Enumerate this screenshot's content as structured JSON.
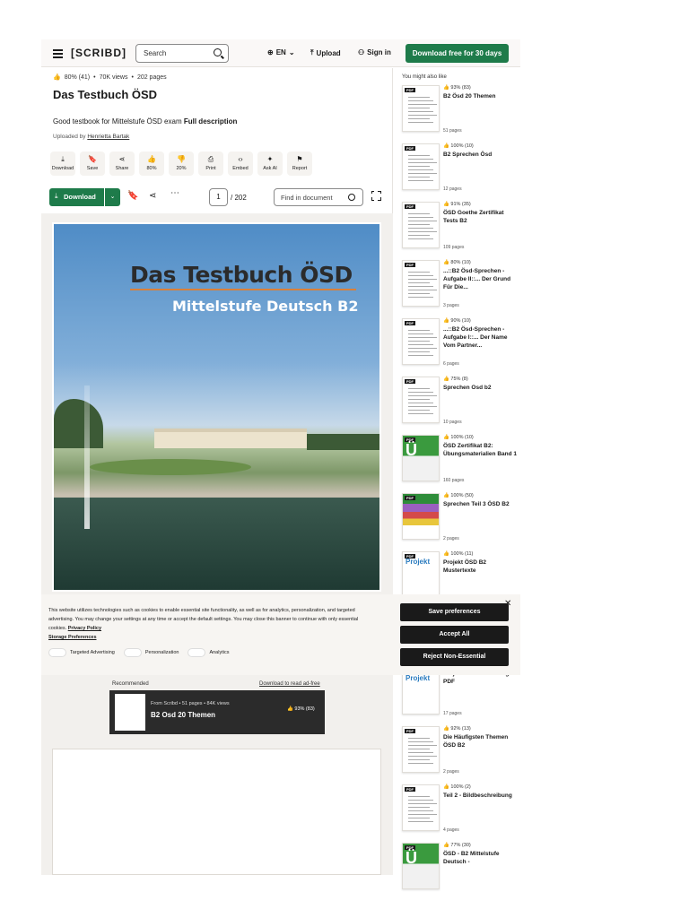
{
  "nav": {
    "logo": "[SCRIBD]",
    "search_placeholder": "Search",
    "language": "EN",
    "upload": "Upload",
    "signin": "Sign in",
    "cta": "Download free for 30 days"
  },
  "doc": {
    "rating": "80% (41)",
    "views": "70K views",
    "pages": "202 pages",
    "title": "Das Testbuch ÖSD",
    "description": "Good testbook for Mittelstufe ÖSD exam",
    "full_description": "Full description",
    "uploaded_by_label": "Uploaded by",
    "uploader": "Henrietta Bartak",
    "actions": [
      {
        "icon": "download-icon",
        "glyph": "⤓",
        "label": "Download"
      },
      {
        "icon": "bookmark-icon",
        "glyph": "🔖",
        "label": "Save"
      },
      {
        "icon": "share-icon",
        "glyph": "⋖",
        "label": "Share"
      },
      {
        "icon": "thumbs-up-icon",
        "glyph": "👍",
        "label": "80%"
      },
      {
        "icon": "thumbs-down-icon",
        "glyph": "👎",
        "label": "20%"
      },
      {
        "icon": "print-icon",
        "glyph": "⎙",
        "label": "Print"
      },
      {
        "icon": "embed-icon",
        "glyph": "‹›",
        "label": "Embed"
      },
      {
        "icon": "ask-ai-icon",
        "glyph": "✦",
        "label": "Ask AI"
      },
      {
        "icon": "flag-icon",
        "glyph": "⚑",
        "label": "Report"
      }
    ],
    "toolbar": {
      "download": "Download",
      "current_page": "1",
      "total_pages": "/ 202",
      "find_placeholder": "Find in document"
    },
    "cover": {
      "title": "Das Testbuch ÖSD",
      "subtitle": "Mittelstufe Deutsch B2"
    },
    "recommended": {
      "label": "Recommended",
      "link": "Download to read ad-free",
      "meta": "From Scribd • 51 pages • 84K views",
      "title": "B2 Osd 20 Themen",
      "rating": "93% (83)"
    }
  },
  "cookie": {
    "text": "This website utilizes technologies such as cookies to enable essential site functionality, as well as for analytics, personalization, and targeted advertising. You may change your settings at any time or accept the default settings. You may close this banner to continue with only essential cookies.",
    "privacy_link": "Privacy Policy",
    "storage_link": "Storage Preferences",
    "toggles": [
      "Targeted Advertising",
      "Personalization",
      "Analytics"
    ],
    "save": "Save preferences",
    "accept": "Accept All",
    "reject": "Reject Non-Essential"
  },
  "sidebar": {
    "heading": "You might also like",
    "items": [
      {
        "rating": "93% (83)",
        "title": "B2 Ösd 20 Themen",
        "pages": "51 pages",
        "style": "plain"
      },
      {
        "rating": "100% (10)",
        "title": "B2 Sprechen Ösd",
        "pages": "12 pages",
        "style": "plain"
      },
      {
        "rating": "91% (35)",
        "title": "ÖSD Goethe Zertifikat Tests B2",
        "pages": "109 pages",
        "style": "plain"
      },
      {
        "rating": "80% (10)",
        "title": "...::B2 Ösd-Sprechen - Aufgabe II::... Der Grund Für Die...",
        "pages": "3 pages",
        "style": "plain"
      },
      {
        "rating": "90% (10)",
        "title": "...::B2 Ösd-Sprechen - Aufgabe I::... Der Name Vom Partner...",
        "pages": "6 pages",
        "style": "plain"
      },
      {
        "rating": "75% (8)",
        "title": "Sprechen Osd b2",
        "pages": "10 pages",
        "style": "plain"
      },
      {
        "rating": "100% (10)",
        "title": "ÖSD Zertifikat B2: Übungsmaterialien Band 1",
        "pages": "160 pages",
        "style": "green"
      },
      {
        "rating": "100% (50)",
        "title": "Sprechen Teil 3 ÖSD B2",
        "pages": "2 pages",
        "style": "multi"
      },
      {
        "rating": "100% (11)",
        "title": "Projekt ÖSD B2 Mustertexte",
        "pages": "",
        "style": "projekt"
      },
      {
        "rating": "",
        "title": "Projekt ÖSD B2 Lösungen PDF",
        "pages": "17 pages",
        "style": "projekt"
      },
      {
        "rating": "92% (13)",
        "title": "Die Häufigsten Themen ÖSD B2",
        "pages": "2 pages",
        "style": "plain"
      },
      {
        "rating": "100% (2)",
        "title": "Teil 2 - Bildbeschreibung",
        "pages": "4 pages",
        "style": "plain"
      },
      {
        "rating": "77% (30)",
        "title": "ÖSD - B2 Mittelstufe Deutsch -",
        "pages": "",
        "style": "green"
      }
    ]
  }
}
